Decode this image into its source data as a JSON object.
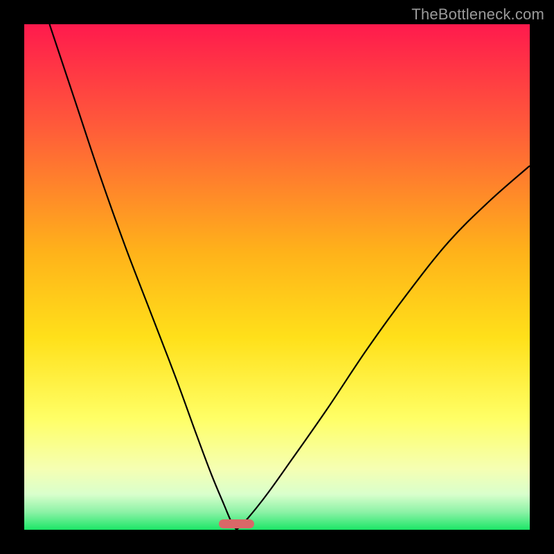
{
  "watermark": "TheBottleneck.com",
  "colors": {
    "top": "#ff1a4d",
    "upper_mid": "#ff6b3d",
    "mid": "#ffd31a",
    "lower_mid": "#ffff80",
    "pale": "#e6ffcc",
    "green": "#1ce667",
    "curve": "#000000",
    "marker": "#d96868",
    "frame": "#000000"
  },
  "chart_data": {
    "type": "line",
    "title": "",
    "xlabel": "",
    "ylabel": "",
    "xlim": [
      0,
      100
    ],
    "ylim": [
      0,
      100
    ],
    "grid": false,
    "legend": false,
    "notch_x": 42,
    "marker": {
      "x_center": 42,
      "width_pct": 7,
      "y_pct": 98.8
    },
    "series": [
      {
        "name": "left-branch",
        "x": [
          5,
          10,
          15,
          20,
          25,
          30,
          34,
          37,
          39.5,
          41,
          42
        ],
        "y": [
          100,
          85,
          70,
          56,
          43,
          30,
          19,
          11,
          5,
          1.5,
          0
        ]
      },
      {
        "name": "right-branch",
        "x": [
          42,
          44,
          48,
          53,
          60,
          68,
          76,
          84,
          92,
          100
        ],
        "y": [
          0,
          2,
          7,
          14,
          24,
          36,
          47,
          57,
          65,
          72
        ]
      }
    ],
    "gradient_stops": [
      {
        "offset": 0,
        "color": "#ff1a4d"
      },
      {
        "offset": 20,
        "color": "#ff5a3a"
      },
      {
        "offset": 45,
        "color": "#ffb21a"
      },
      {
        "offset": 62,
        "color": "#ffe01a"
      },
      {
        "offset": 78,
        "color": "#ffff66"
      },
      {
        "offset": 88,
        "color": "#f5ffb3"
      },
      {
        "offset": 93,
        "color": "#d9ffcc"
      },
      {
        "offset": 96.5,
        "color": "#8cf2a6"
      },
      {
        "offset": 100,
        "color": "#1ce667"
      }
    ]
  }
}
